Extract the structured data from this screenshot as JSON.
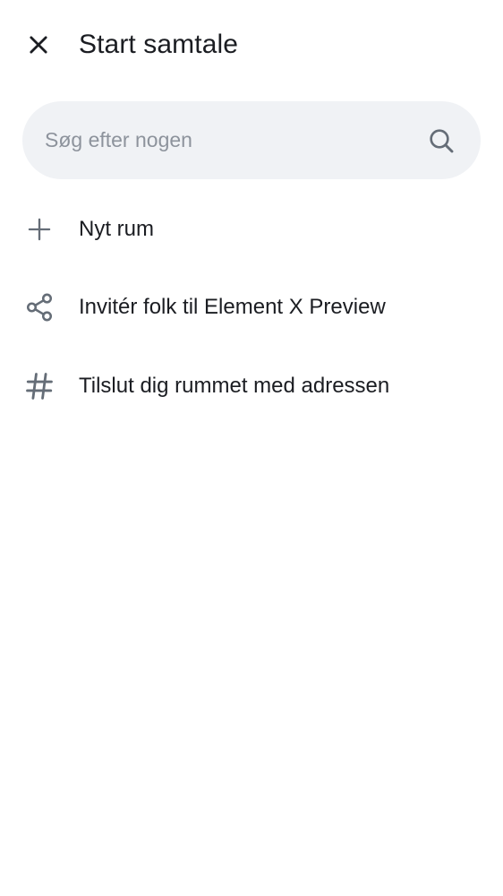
{
  "header": {
    "close_icon": "close-icon",
    "title": "Start samtale"
  },
  "search": {
    "placeholder": "Søg efter nogen",
    "value": "",
    "icon": "search-icon"
  },
  "actions": [
    {
      "icon": "plus-icon",
      "label": "Nyt rum"
    },
    {
      "icon": "share-icon",
      "label": "Invitér folk til Element X Preview"
    },
    {
      "icon": "hash-icon",
      "label": "Tilslut dig rummet med adressen"
    }
  ],
  "colors": {
    "text": "#1b1d22",
    "icon": "#656d77",
    "search_bg": "#f0f2f5",
    "placeholder": "#8d939c"
  }
}
